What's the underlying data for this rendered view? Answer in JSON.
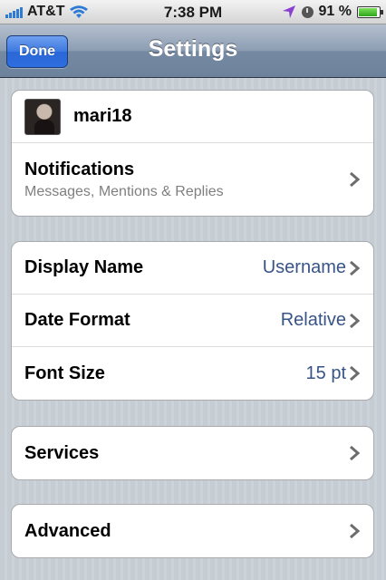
{
  "status_bar": {
    "carrier": "AT&T",
    "time": "7:38 PM",
    "battery_text": "91 %",
    "battery_level": 0.91,
    "icons": [
      "signal-icon",
      "wifi-icon",
      "location-icon",
      "clock-icon",
      "battery-icon"
    ]
  },
  "nav": {
    "done_label": "Done",
    "title": "Settings"
  },
  "account": {
    "username": "mari18",
    "notifications_label": "Notifications",
    "notifications_sub": "Messages, Mentions & Replies"
  },
  "display": {
    "rows": [
      {
        "label": "Display Name",
        "value": "Username"
      },
      {
        "label": "Date Format",
        "value": "Relative"
      },
      {
        "label": "Font Size",
        "value": "15 pt"
      }
    ]
  },
  "services_label": "Services",
  "advanced_label": "Advanced",
  "colors": {
    "accent_value": "#385487",
    "done_button": "#2f6ee0",
    "nav_bar": "#7589a2"
  }
}
